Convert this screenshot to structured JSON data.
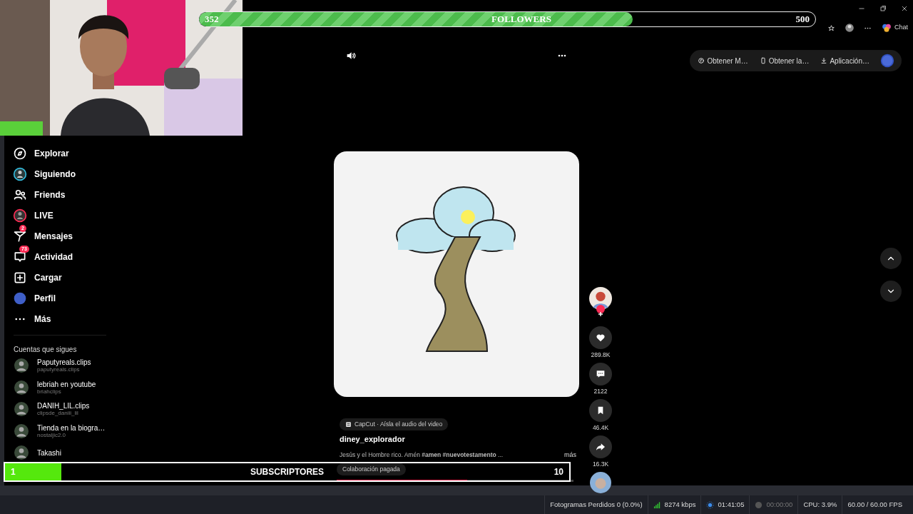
{
  "stream_overlay": {
    "followers_goal": {
      "current": "352",
      "label": "FOLLOWERS",
      "target": "500",
      "level": 0.704
    },
    "subscribers_goal": {
      "current": "1",
      "label": "SUBSCRIPTORES",
      "target": "10",
      "level": 0.1
    }
  },
  "browser": {
    "chat_label": "Chat"
  },
  "sidebar": {
    "items": [
      {
        "kind": "explore",
        "label": "Explorar"
      },
      {
        "kind": "following",
        "label": "Siguiendo"
      },
      {
        "kind": "friends",
        "label": "Friends"
      },
      {
        "kind": "live",
        "label": "LIVE"
      },
      {
        "kind": "messages",
        "label": "Mensajes",
        "badge": "2"
      },
      {
        "kind": "activity",
        "label": "Actividad",
        "badge": "73"
      },
      {
        "kind": "upload",
        "label": "Cargar"
      },
      {
        "kind": "profile",
        "label": "Perfil"
      },
      {
        "kind": "more",
        "label": "Más"
      }
    ],
    "section_title": "Cuentas que sigues",
    "accounts": [
      {
        "name": "Paputyreals.clips",
        "handle": "paputyreals.clips"
      },
      {
        "name": "lebriah en youtube",
        "handle": "briahclips"
      },
      {
        "name": "DANIH_LIL.clips",
        "handle": "clipsde_daniii_lil"
      },
      {
        "name": "Tienda en la biogra…",
        "handle": "nostaljic2.0"
      },
      {
        "name": "Takashi"
      }
    ]
  },
  "header": {
    "buttons": [
      {
        "kind": "music",
        "label": "Obtener M…"
      },
      {
        "kind": "phone",
        "label": "Obtener la…"
      },
      {
        "kind": "download",
        "label": "Aplicación…"
      }
    ]
  },
  "video": {
    "actions": [
      {
        "kind": "author"
      },
      {
        "kind": "like",
        "count": "289.8K"
      },
      {
        "kind": "comment",
        "count": "2122"
      },
      {
        "kind": "save",
        "count": "46.4K"
      },
      {
        "kind": "share",
        "count": "16.3K"
      },
      {
        "kind": "sound"
      }
    ],
    "effect_label": "CapCut · Aísla el audio del video",
    "author": "diney_explorador",
    "description": "Jesús y el Hombre rico. Amén **#amen #nuevotestamento** ...",
    "more": "más",
    "paid_label": "Colaboración pagada",
    "progress": {
      "level": 0.55
    }
  },
  "status_bar": {
    "dropped": "Fotogramas Perdidos 0 (0.0%)",
    "bitrate": "8274 kbps",
    "stream_time": "01:41:05",
    "record_time": "00:00:00",
    "cpu": "CPU: 3.9%",
    "fps": "60.00 / 60.00 FPS"
  }
}
